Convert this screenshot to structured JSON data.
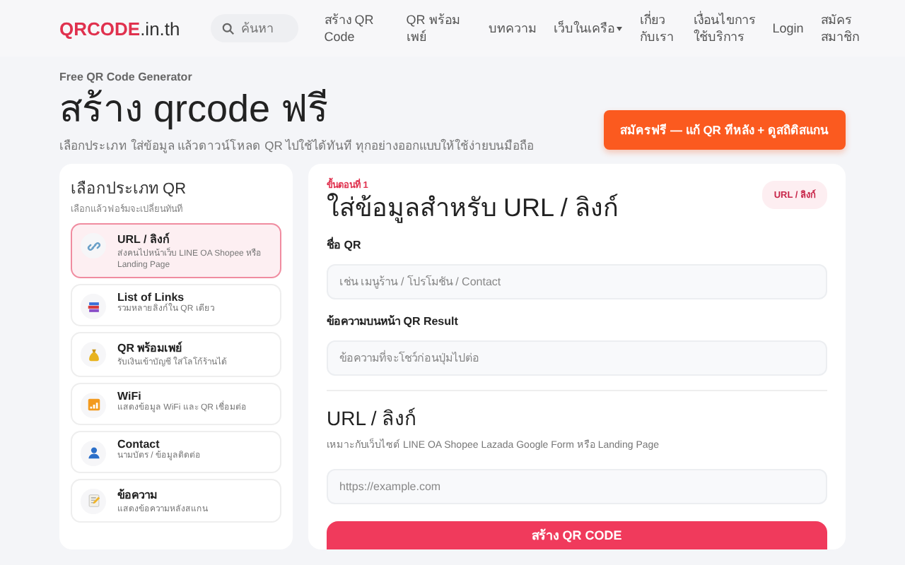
{
  "header": {
    "logo": {
      "main": "QRCODE",
      "suffix": ".in.th"
    },
    "search": {
      "placeholder": "ค้นหา"
    },
    "nav": [
      {
        "label": "สร้าง QR Code",
        "dropdown": false
      },
      {
        "label": "QR พร้อมเพย์",
        "dropdown": false
      },
      {
        "label": "บทความ",
        "dropdown": false
      },
      {
        "label": "เว็บในเครือ",
        "dropdown": true
      },
      {
        "label": "เกี่ยวกับเรา",
        "dropdown": false
      },
      {
        "label": "เงื่อนไขการใช้บริการ",
        "dropdown": false
      },
      {
        "label": "Login",
        "dropdown": false
      },
      {
        "label": "สมัครสมาชิก",
        "dropdown": false
      }
    ]
  },
  "hero": {
    "eyebrow": "Free QR Code Generator",
    "title": "สร้าง qrcode ฟรี",
    "subtitle": "เลือกประเภท ใส่ข้อมูล แล้วดาวน์โหลด QR ไปใช้ได้ทันที ทุกอย่างออกแบบให้ใช้ง่ายบนมือถือ",
    "cta": "สมัครฟรี — แก้ QR ทีหลัง + ดูสถิติสแกน"
  },
  "types": {
    "title": "เลือกประเภท QR",
    "subtitle": "เลือกแล้วฟอร์มจะเปลี่ยนทันที",
    "items": [
      {
        "kind": "link",
        "name": "URL / ลิงก์",
        "desc": "ส่งคนไปหน้าเว็บ LINE OA Shopee หรือ Landing Page",
        "selected": true
      },
      {
        "kind": "list",
        "name": "List of Links",
        "desc": "รวมหลายลิงก์ใน QR เดียว",
        "selected": false
      },
      {
        "kind": "payment",
        "name": "QR พร้อมเพย์",
        "desc": "รับเงินเข้าบัญชี ใส่โลโก้ร้านได้",
        "selected": false
      },
      {
        "kind": "wifi",
        "name": "WiFi",
        "desc": "แสดงข้อมูล WiFi และ QR เชื่อมต่อ",
        "selected": false
      },
      {
        "kind": "contact",
        "name": "Contact",
        "desc": "นามบัตร / ข้อมูลติดต่อ",
        "selected": false
      },
      {
        "kind": "text",
        "name": "ข้อความ",
        "desc": "แสดงข้อความหลังสแกน",
        "selected": false
      }
    ]
  },
  "form": {
    "step": "ขั้นตอนที่ 1",
    "title": "ใส่ข้อมูลสำหรับ URL / ลิงก์",
    "badge": "URL / ลิงก์",
    "fields": [
      {
        "label": "ชื่อ QR",
        "placeholder": "เช่น เมนูร้าน / โปรโมชัน / Contact"
      },
      {
        "label": "ข้อความบนหน้า QR Result",
        "placeholder": "ข้อความที่จะโชว์ก่อนปุ่มไปต่อ"
      }
    ],
    "section": {
      "title": "URL / ลิงก์",
      "hint": "เหมาะกับเว็บไซต์ LINE OA Shopee Lazada Google Form หรือ Landing Page",
      "placeholder": "https://example.com"
    },
    "submit": "สร้าง QR CODE"
  }
}
